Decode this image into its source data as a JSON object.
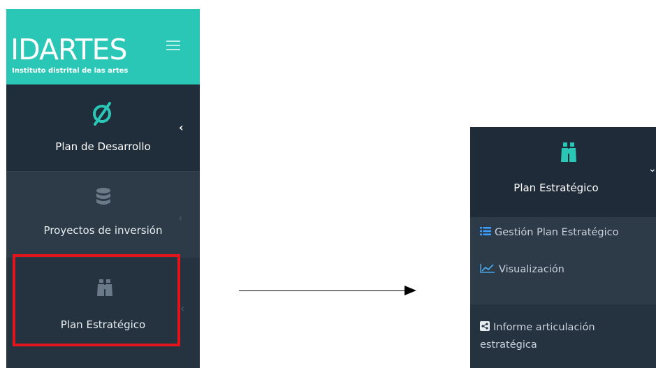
{
  "brand": {
    "name": "IDARTES",
    "tagline": "Instituto distrital de las artes"
  },
  "sidebar": {
    "items": [
      {
        "label": "Plan de Desarrollo",
        "icon": "strategy-loop-icon",
        "state": "collapsed"
      },
      {
        "label": "Proyectos de inversión",
        "icon": "database-icon",
        "state": "collapsed"
      },
      {
        "label": "Plan Estratégico",
        "icon": "binoculars-icon",
        "state": "collapsed",
        "highlighted": true
      }
    ]
  },
  "expanded_menu": {
    "title": "Plan Estratégico",
    "icon": "binoculars-icon",
    "state": "expanded",
    "subitems": [
      {
        "label": "Gestión Plan Estratégico",
        "icon": "list-icon"
      },
      {
        "label": "Visualización",
        "icon": "chart-line-icon"
      }
    ],
    "extra_item": {
      "line1": "Informe articulación",
      "line2": "estratégica",
      "icon": "share-square-icon"
    }
  },
  "colors": {
    "brand_teal": "#2ac7b6",
    "sidebar_dark": "#253341",
    "highlight_red": "#e0161c"
  }
}
